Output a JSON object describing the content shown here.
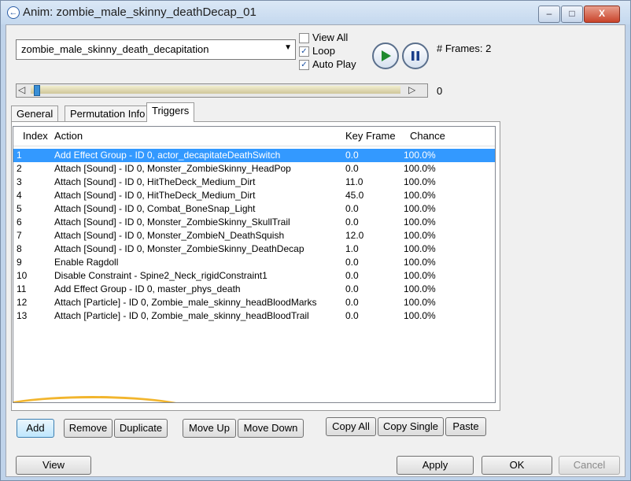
{
  "window": {
    "title": "Anim: zombie_male_skinny_deathDecap_01",
    "controls": [
      "–",
      "□",
      "X"
    ]
  },
  "animation": {
    "selected": "zombie_male_skinny_death_decapitation"
  },
  "options": {
    "view_all": "View All",
    "loop": "Loop",
    "auto_play": "Auto Play"
  },
  "frames": {
    "label": "# Frames:",
    "value": "2"
  },
  "slider": {
    "value": "0"
  },
  "tabs": [
    "General",
    "Permutation Info",
    "Triggers"
  ],
  "list": {
    "columns": [
      "Index",
      "Action",
      "Key Frame",
      "Chance"
    ],
    "rows": [
      {
        "index": "1",
        "action": "Add Effect Group - ID 0, actor_decapitateDeathSwitch",
        "key": "0.0",
        "chance": "100.0%",
        "selected": true
      },
      {
        "index": "2",
        "action": "Attach [Sound] - ID 0, Monster_ZombieSkinny_HeadPop",
        "key": "0.0",
        "chance": "100.0%"
      },
      {
        "index": "3",
        "action": "Attach [Sound] - ID 0, HitTheDeck_Medium_Dirt",
        "key": "11.0",
        "chance": "100.0%"
      },
      {
        "index": "4",
        "action": "Attach [Sound] - ID 0, HitTheDeck_Medium_Dirt",
        "key": "45.0",
        "chance": "100.0%"
      },
      {
        "index": "5",
        "action": "Attach [Sound] - ID 0, Combat_BoneSnap_Light",
        "key": "0.0",
        "chance": "100.0%"
      },
      {
        "index": "6",
        "action": "Attach [Sound] - ID 0, Monster_ZombieSkinny_SkullTrail",
        "key": "0.0",
        "chance": "100.0%"
      },
      {
        "index": "7",
        "action": "Attach [Sound] - ID 0, Monster_ZombieN_DeathSquish",
        "key": "12.0",
        "chance": "100.0%"
      },
      {
        "index": "8",
        "action": "Attach [Sound] - ID 0, Monster_ZombieSkinny_DeathDecap",
        "key": "1.0",
        "chance": "100.0%"
      },
      {
        "index": "9",
        "action": "Enable Ragdoll",
        "key": "0.0",
        "chance": "100.0%"
      },
      {
        "index": "10",
        "action": "Disable Constraint - Spine2_Neck_rigidConstraint1",
        "key": "0.0",
        "chance": "100.0%"
      },
      {
        "index": "11",
        "action": "Add Effect Group - ID 0, master_phys_death",
        "key": "0.0",
        "chance": "100.0%"
      },
      {
        "index": "12",
        "action": "Attach [Particle] - ID 0, Zombie_male_skinny_headBloodMarks",
        "key": "0.0",
        "chance": "100.0%"
      },
      {
        "index": "13",
        "action": "Attach [Particle] - ID 0, Zombie_male_skinny_headBloodTrail",
        "key": "0.0",
        "chance": "100.0%"
      }
    ]
  },
  "buttons": {
    "add": "Add",
    "remove": "Remove",
    "duplicate": "Duplicate",
    "move_up": "Move Up",
    "move_down": "Move Down",
    "copy_all": "Copy All",
    "copy_single": "Copy Single",
    "paste": "Paste",
    "view": "View",
    "apply": "Apply",
    "ok": "OK",
    "cancel": "Cancel"
  },
  "colors": {
    "selection": "#3399ff",
    "highlight_ring": "#f2b52d"
  }
}
